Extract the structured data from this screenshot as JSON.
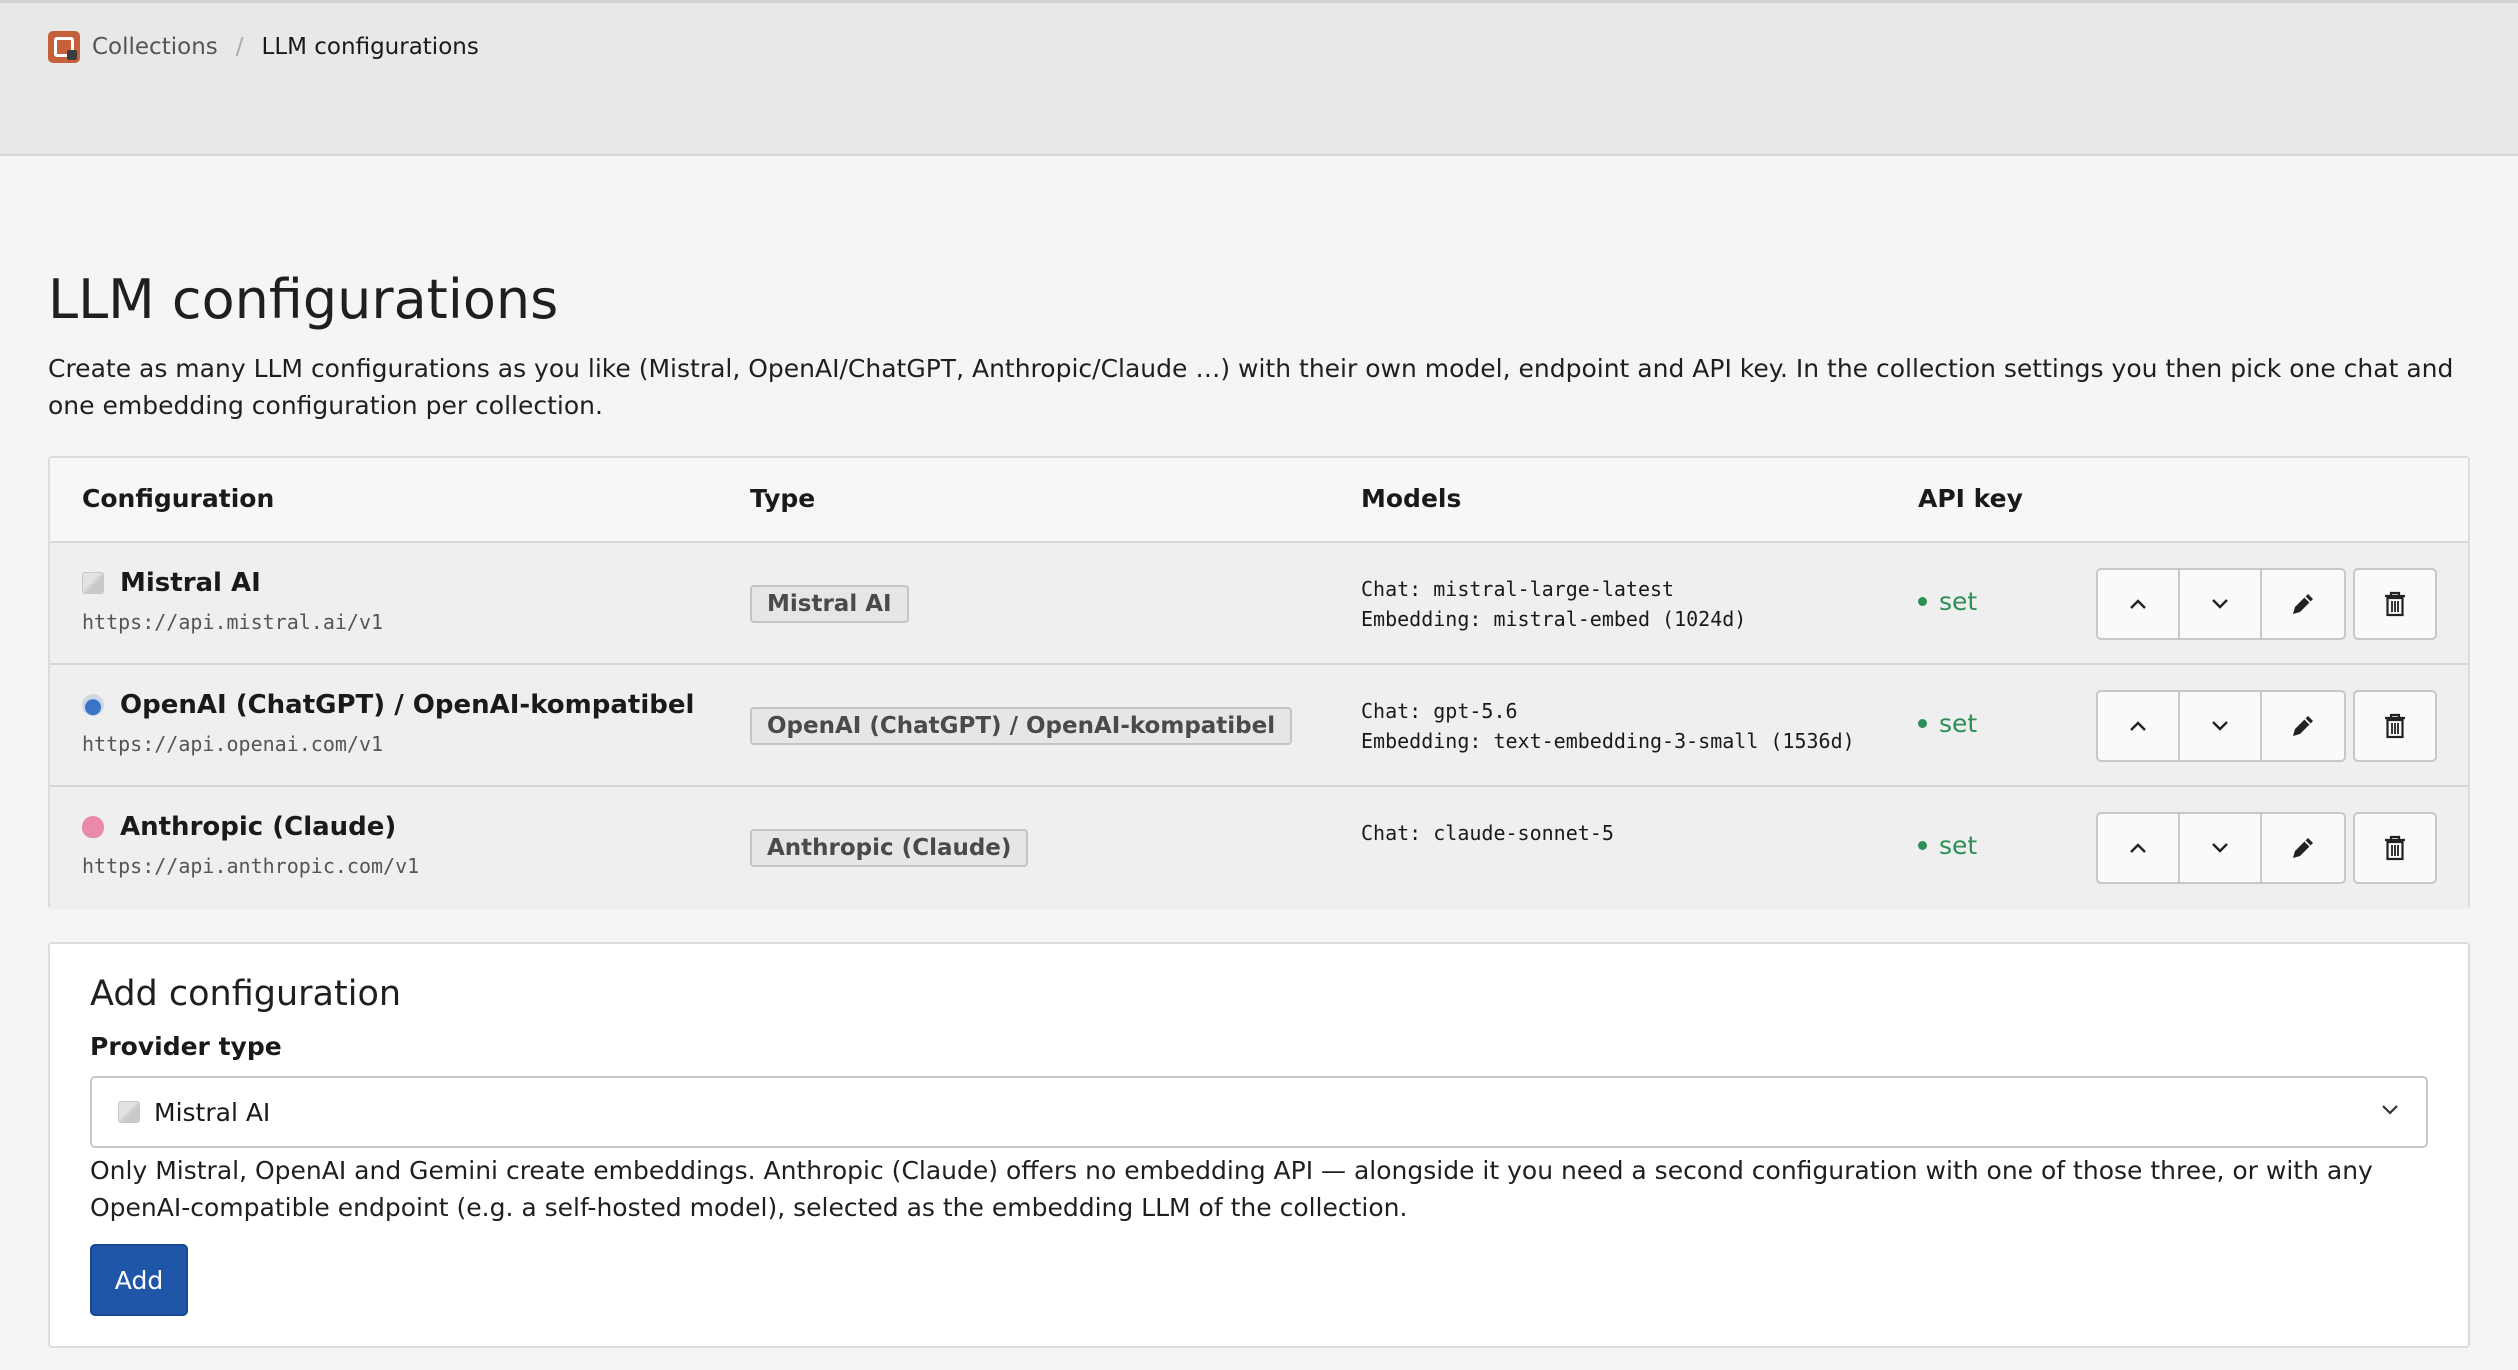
{
  "breadcrumb": {
    "collections": "Collections",
    "separator": "/",
    "current": "LLM configurations"
  },
  "page": {
    "title": "LLM configurations",
    "description": "Create as many LLM configurations as you like (Mistral, OpenAI/ChatGPT, Anthropic/Claude …) with their own model, endpoint and API key. In the collection settings you then pick one chat and one embedding configuration per collection."
  },
  "table": {
    "headers": {
      "configuration": "Configuration",
      "type": "Type",
      "models": "Models",
      "api_key": "API key"
    },
    "rows": [
      {
        "icon": "mistral-icon",
        "name": "Mistral AI",
        "url": "https://api.mistral.ai/v1",
        "type": "Mistral AI",
        "chat": "Chat: mistral-large-latest",
        "embedding": "Embedding: mistral-embed (1024d)",
        "api_key": "set"
      },
      {
        "icon": "openai-icon",
        "name": "OpenAI (ChatGPT) / OpenAI-kompatibel",
        "url": "https://api.openai.com/v1",
        "type": "OpenAI (ChatGPT) / OpenAI-kompatibel",
        "chat": "Chat: gpt-5.6",
        "embedding": "Embedding: text-embedding-3-small (1536d)",
        "api_key": "set"
      },
      {
        "icon": "anthropic-icon",
        "name": "Anthropic (Claude)",
        "url": "https://api.anthropic.com/v1",
        "type": "Anthropic (Claude)",
        "chat": "Chat: claude-sonnet-5",
        "embedding": "",
        "api_key": "set"
      }
    ]
  },
  "add_form": {
    "title": "Add configuration",
    "provider_label": "Provider type",
    "provider_selected": "Mistral AI",
    "hint": "Only Mistral, OpenAI and Gemini create embeddings. Anthropic (Claude) offers no embedding API — alongside it you need a second configuration with one of those three, or with any OpenAI-compatible endpoint (e.g. a self-hosted model), selected as the embedding LLM of the collection.",
    "add_label": "Add"
  },
  "colors": {
    "accent": "#1f56a8",
    "status_set": "#2d8f56",
    "app_logo": "#c4603a"
  }
}
